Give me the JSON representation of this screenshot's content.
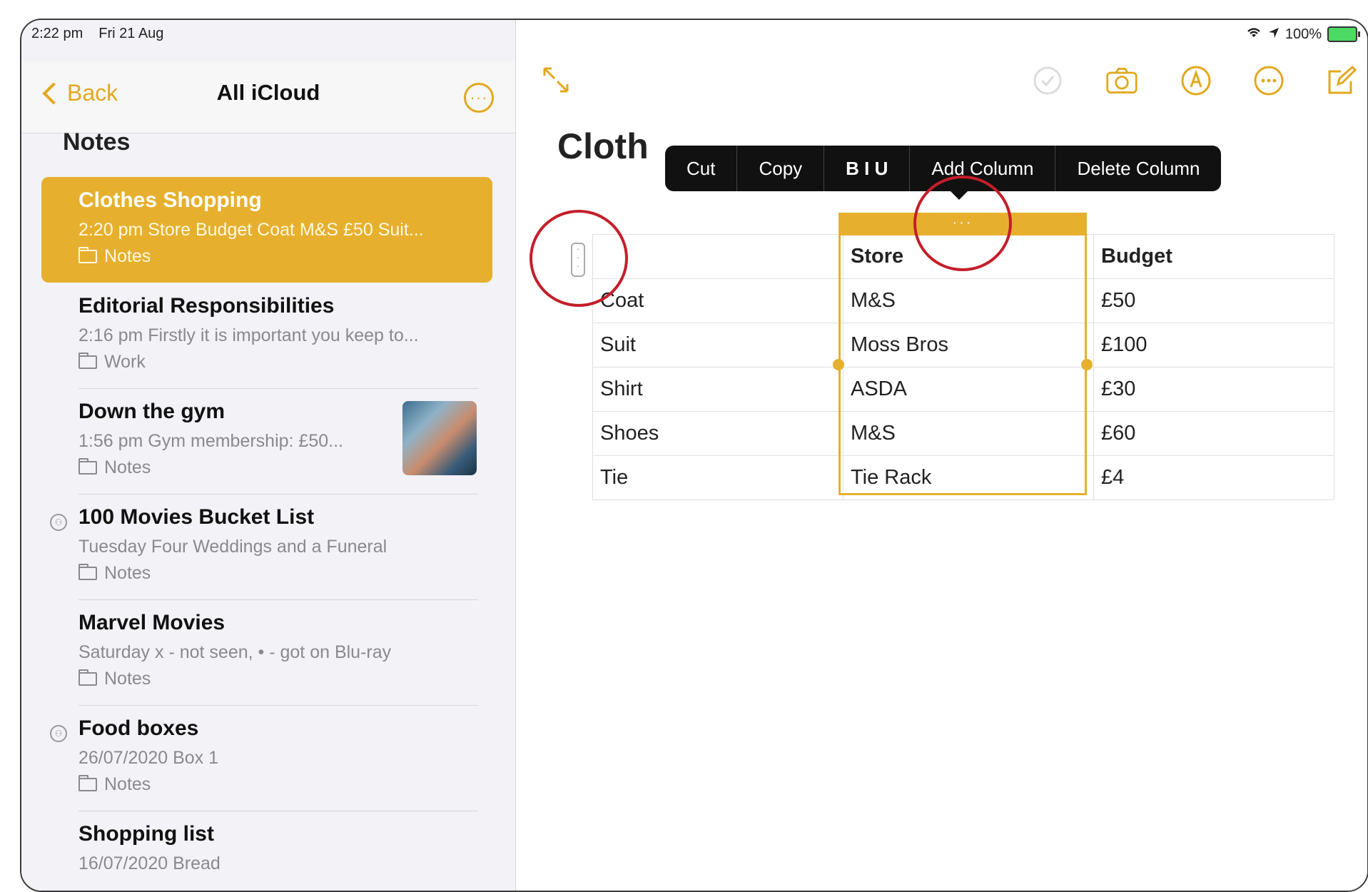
{
  "status": {
    "time": "2:22 pm",
    "date": "Fri 21 Aug",
    "battery": "100%"
  },
  "sidebar": {
    "back_label": "Back",
    "title": "All iCloud",
    "section_heading": "Notes",
    "notes": [
      {
        "title": "Clothes Shopping",
        "subtitle": "2:20 pm  Store Budget Coat M&S £50 Suit...",
        "folder": "Notes",
        "selected": true
      },
      {
        "title": "Editorial Responsibilities",
        "subtitle": "2:16 pm  Firstly it is important you keep to...",
        "folder": "Work"
      },
      {
        "title": "Down the gym",
        "subtitle": "1:56 pm  Gym membership: £50...",
        "folder": "Notes",
        "has_thumbnail": true
      },
      {
        "title": "100 Movies Bucket List",
        "subtitle": "Tuesday  Four Weddings and a Funeral",
        "folder": "Notes",
        "shared": true
      },
      {
        "title": "Marvel Movies",
        "subtitle": "Saturday  x - not seen, • - got on Blu-ray",
        "folder": "Notes"
      },
      {
        "title": "Food boxes",
        "subtitle": "26/07/2020  Box 1",
        "folder": "Notes",
        "shared": true
      },
      {
        "title": "Shopping list",
        "subtitle": "16/07/2020  Bread",
        "folder": ""
      }
    ]
  },
  "main": {
    "title": "Cloth",
    "context_menu": [
      "Cut",
      "Copy",
      "B I U",
      "Add Column",
      "Delete Column"
    ],
    "column_handle": "···",
    "table": {
      "header": [
        "",
        "Store",
        "Budget"
      ],
      "rows": [
        [
          "Coat",
          "M&S",
          "£50"
        ],
        [
          "Suit",
          "Moss Bros",
          "£100"
        ],
        [
          "Shirt",
          "ASDA",
          "£30"
        ],
        [
          "Shoes",
          "M&S",
          "£60"
        ],
        [
          "Tie",
          "Tie Rack",
          "£4"
        ]
      ]
    }
  },
  "colors": {
    "accent": "#e6b02e",
    "annotation": "#c41e2a"
  }
}
